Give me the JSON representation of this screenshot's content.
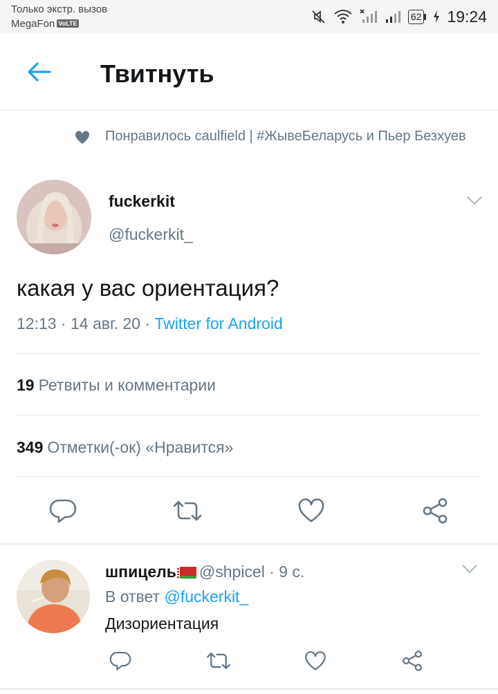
{
  "status_bar": {
    "carrier_line1": "Только экстр. вызов",
    "carrier_line2": "MegaFon",
    "volte_badge": "VoLTE",
    "battery": "62",
    "time": "19:24"
  },
  "header": {
    "title": "Твитнуть"
  },
  "context": {
    "icon": "heart-icon",
    "text": "Понравилось caulfield | #ЖывеБеларусь и Пьер Безхуев"
  },
  "tweet": {
    "author_name": "fuckerkit",
    "author_handle": "@fuckerkit_",
    "text": "какая у вас ориентация?",
    "time": "12:13 · 14 авг. 20 · ",
    "client": "Twitter for Android",
    "retweets_count": "19",
    "retweets_label": "Ретвиты и комментарии",
    "likes_count": "349",
    "likes_label": "Отметки(-ок) «Нравится»"
  },
  "reply": {
    "author_name": "шпицель",
    "author_handle": "@shpicel",
    "age": " · 9 с.",
    "reply_prefix": "В ответ ",
    "reply_mention": "@fuckerkit_",
    "text": "Дизориентация"
  },
  "colors": {
    "accent": "#1da1f2",
    "secondary_text": "#657786",
    "divider": "#e1e8ed"
  }
}
